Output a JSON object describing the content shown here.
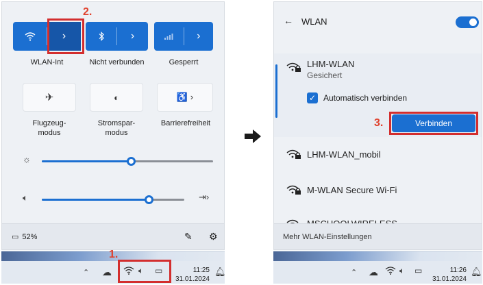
{
  "quick_settings": {
    "tiles": [
      {
        "label": "WLAN-Int"
      },
      {
        "label": "Nicht verbunden"
      },
      {
        "label": "Gesperrt"
      },
      {
        "label": "Flugzeug-\nmodus"
      },
      {
        "label": "Stromspar-\nmodus"
      },
      {
        "label": "Barrierefreiheit"
      }
    ],
    "brightness_level": 0.52,
    "volume_level": 0.75,
    "battery_text": "52%"
  },
  "steps": {
    "one": "1.",
    "two": "2.",
    "three": "3."
  },
  "taskbar_left": {
    "time": "11:25",
    "date": "31.01.2024"
  },
  "taskbar_right": {
    "time": "11:26",
    "date": "31.01.2024"
  },
  "wlan_panel": {
    "back": "←",
    "title": "WLAN",
    "selected_network": {
      "name": "LHM-WLAN",
      "status": "Gesichert",
      "auto_connect_label": "Automatisch verbinden",
      "connect_button": "Verbinden"
    },
    "networks": [
      {
        "name": "LHM-WLAN_mobil"
      },
      {
        "name": "M-WLAN Secure Wi-Fi"
      },
      {
        "name": "MSCHOOLWIRELESS"
      }
    ],
    "footer_link": "Mehr WLAN-Einstellungen"
  },
  "colors": {
    "accent": "#1b6fd1",
    "callout": "#d32e2e"
  }
}
